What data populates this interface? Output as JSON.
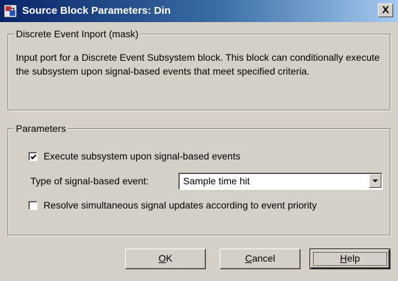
{
  "window": {
    "title": "Source Block Parameters: Din",
    "close_glyph": "X"
  },
  "description_group": {
    "legend": "Discrete Event Inport (mask)",
    "text": "Input port for a Discrete Event Subsystem block. This block can conditionally execute the subsystem upon signal-based events that meet specified criteria."
  },
  "parameters_group": {
    "legend": "Parameters",
    "execute_checkbox": {
      "label": "Execute subsystem upon signal-based events",
      "checked": true
    },
    "event_type": {
      "label": "Type of signal-based event:",
      "value": "Sample time hit"
    },
    "resolve_checkbox": {
      "label": "Resolve simultaneous signal updates according to event priority",
      "checked": false
    }
  },
  "buttons": {
    "ok": {
      "mnemonic": "O",
      "rest": "K"
    },
    "cancel": {
      "mnemonic": "C",
      "rest": "ancel"
    },
    "help": {
      "mnemonic": "H",
      "rest": "elp"
    }
  },
  "colors": {
    "title_bar_start": "#0a246a",
    "title_bar_end": "#a6caf0",
    "dialog_face": "#d4d0c8"
  },
  "icons": [
    "simulink-block-icon",
    "checkmark-icon",
    "dropdown-arrow-icon"
  ]
}
